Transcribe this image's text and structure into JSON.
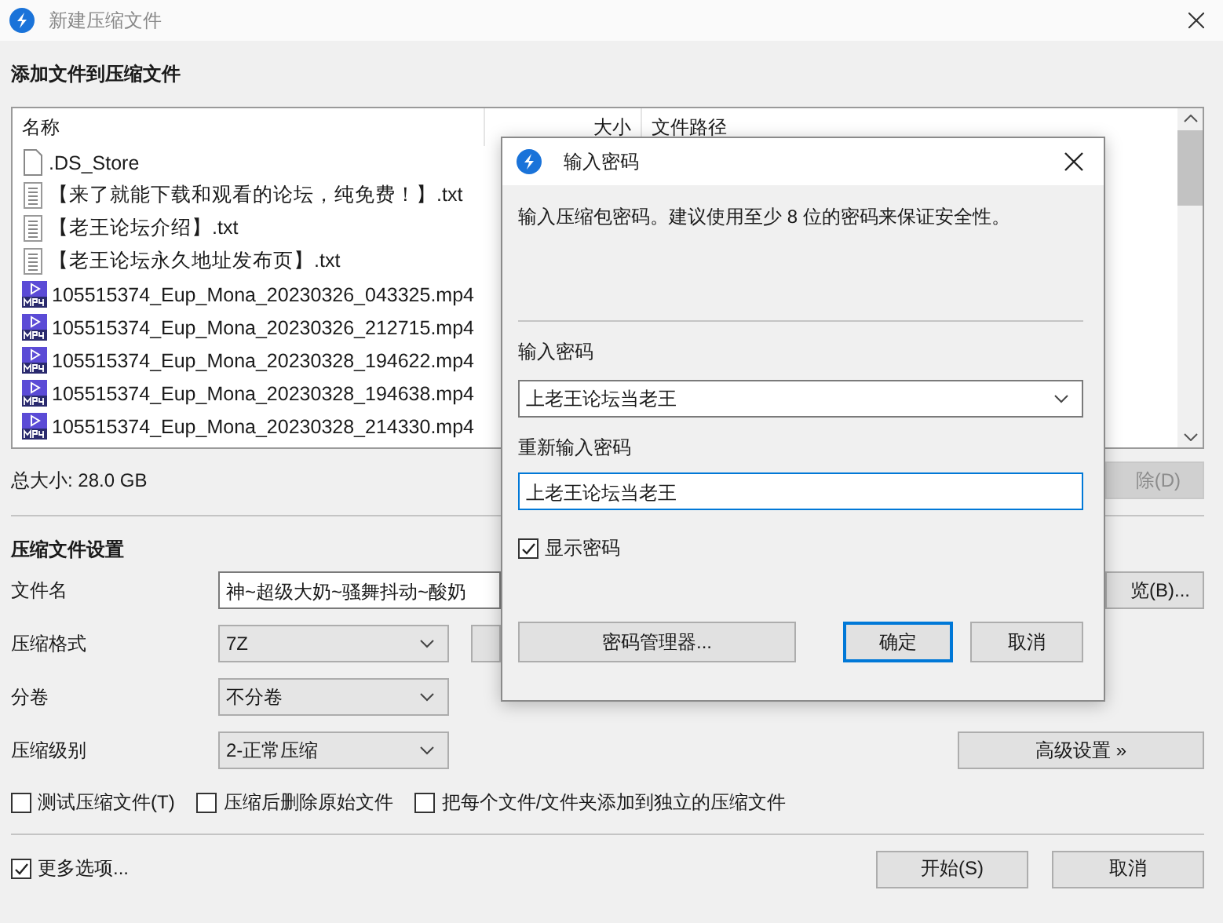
{
  "window": {
    "title": "新建压缩文件"
  },
  "add_files": {
    "heading": "添加文件到压缩文件",
    "file_list": {
      "columns": [
        "名称",
        "大小",
        "文件路径"
      ],
      "rows": [
        {
          "kind": "blank",
          "name": ".DS_Store"
        },
        {
          "kind": "text",
          "name": "【来了就能下载和观看的论坛，纯免费！】.txt"
        },
        {
          "kind": "text",
          "name": "【老王论坛介绍】.txt"
        },
        {
          "kind": "text",
          "name": "【老王论坛永久地址发布页】.txt"
        },
        {
          "kind": "video",
          "name": "105515374_Eup_Mona_20230326_043325.mp4"
        },
        {
          "kind": "video",
          "name": "105515374_Eup_Mona_20230326_212715.mp4"
        },
        {
          "kind": "video",
          "name": "105515374_Eup_Mona_20230328_194622.mp4"
        },
        {
          "kind": "video",
          "name": "105515374_Eup_Mona_20230328_194638.mp4"
        },
        {
          "kind": "video",
          "name": "105515374_Eup_Mona_20230328_214330.mp4"
        }
      ]
    },
    "total_size": "总大小: 28.0 GB",
    "delete_button": {
      "label": "除(D)",
      "disabled": true
    }
  },
  "settings": {
    "heading": "压缩文件设置",
    "rows": [
      {
        "kind": "field",
        "label": "文件名",
        "value": "神~超级大奶~骚舞抖动~酸奶"
      },
      {
        "kind": "select",
        "label": "压缩格式",
        "value": "7Z"
      },
      {
        "kind": "select",
        "label": "分卷",
        "value": "不分卷"
      },
      {
        "kind": "select",
        "label": "压缩级别",
        "value": "2-正常压缩"
      }
    ],
    "browse_button": "览(B)...",
    "advanced_button": "高级设置 »",
    "options": [
      {
        "label": "测试压缩文件(T)",
        "checked": false
      },
      {
        "label": "压缩后删除原始文件",
        "checked": false
      },
      {
        "label": "把每个文件/文件夹添加到独立的压缩文件",
        "checked": false
      }
    ]
  },
  "more_options": {
    "label": "更多选项...",
    "checked": true
  },
  "buttons": [
    {
      "label": "开始(S)"
    },
    {
      "label": "取消"
    }
  ],
  "dialog": {
    "title": "输入密码",
    "description": "输入压缩包密码。建议使用至少 8 位的密码来保证安全性。",
    "password_label": "输入密码",
    "password_value": "上老王论坛当老王",
    "confirm_label": "重新输入密码",
    "confirm_value": "上老王论坛当老王",
    "show_password": {
      "label": "显示密码",
      "checked": true
    },
    "buttons": [
      {
        "label": "密码管理器...",
        "focused": false
      },
      {
        "label": "确定",
        "focused": true
      },
      {
        "label": "取消",
        "focused": false
      }
    ]
  }
}
